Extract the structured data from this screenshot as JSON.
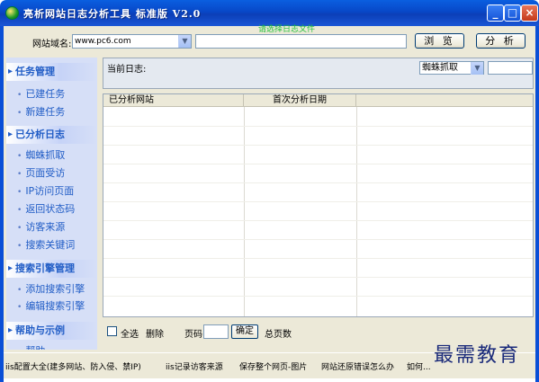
{
  "window": {
    "title": "亮析网站日志分析工具 标准版 V2.0",
    "controls": [
      "_",
      "□",
      "×"
    ]
  },
  "toolbar": {
    "domain_label": "网站域名:",
    "domain_value": "www.pc6.com",
    "green_notice": "请选择日志文件",
    "browse_label": "浏 览",
    "analyze_label": "分 析"
  },
  "sidebar": {
    "sections": [
      {
        "title": "任务管理",
        "items": [
          "已建任务",
          "新建任务"
        ]
      },
      {
        "title": "已分析日志",
        "items": [
          "蜘蛛抓取",
          "页面受访",
          "IP访问页面",
          "返回状态码",
          "访客来源",
          "搜索关键词"
        ]
      },
      {
        "title": "搜索引擎管理",
        "items": [
          "添加搜索引擎",
          "编辑搜索引擎"
        ]
      },
      {
        "title": "帮助与示例",
        "items": [
          "帮助"
        ]
      }
    ]
  },
  "log_panel": {
    "label": "当前日志:",
    "type_selected": "蜘蛛抓取"
  },
  "table": {
    "columns": [
      "已分析网站",
      "首次分析日期"
    ]
  },
  "pager": {
    "select_all": "全选",
    "delete": "删除",
    "page_label": "页码",
    "ok": "确定",
    "total_pages": "总页数"
  },
  "statusbar": {
    "links": [
      "iis配置大全(建多网站、防入侵、禁IP)",
      "iis记录访客来源",
      "保存整个网页-图片",
      "网站还原错误怎么办",
      "如何..."
    ]
  },
  "watermark": "最需教育"
}
